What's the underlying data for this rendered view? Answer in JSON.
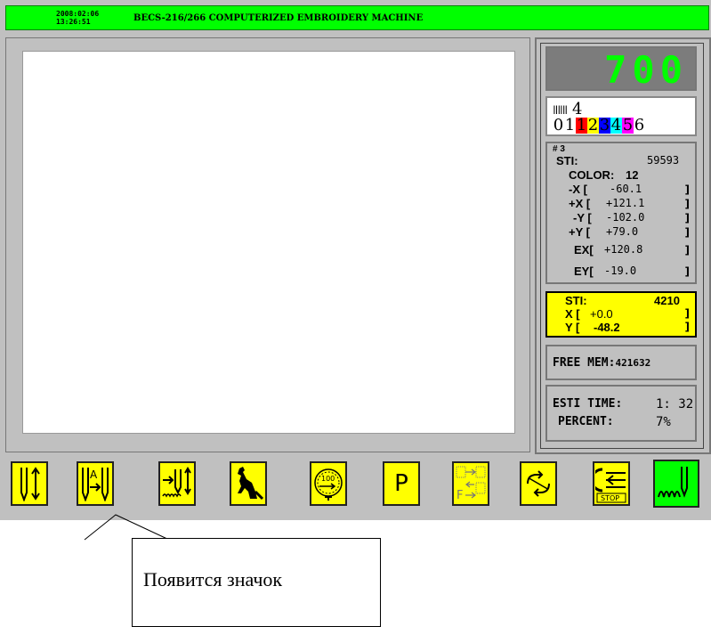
{
  "header": {
    "date": "2008:02:06",
    "time": "13:26:51",
    "title": "BECS-216/266 COMPUTERIZED EMBROIDERY MACHINE"
  },
  "counter": {
    "value": "700",
    "color": "#00ff00"
  },
  "needles": {
    "count_label": "4",
    "colors": [
      {
        "label": "0",
        "bg": "#ffffff",
        "fg": "#000000"
      },
      {
        "label": "1",
        "bg": "#ffffff",
        "fg": "#000000"
      },
      {
        "label": "1",
        "bg": "#ff0000",
        "fg": "#000000"
      },
      {
        "label": "2",
        "bg": "#ffff00",
        "fg": "#000000"
      },
      {
        "label": "3",
        "bg": "#0000ff",
        "fg": "#000000"
      },
      {
        "label": "4",
        "bg": "#00ffff",
        "fg": "#000000"
      },
      {
        "label": "5",
        "bg": "#ff00ff",
        "fg": "#000000"
      },
      {
        "label": "6",
        "bg": "#ffffff",
        "fg": "#000000"
      }
    ]
  },
  "stats": {
    "index": "# 3",
    "sti_label": "STI:",
    "sti_value": "59593",
    "color_label": "COLOR:",
    "color_value": "12",
    "negx_label": "-X [",
    "negx_value": "-60.1",
    "posx_label": "+X [",
    "posx_value": "+121.1",
    "negy_label": "-Y [",
    "negy_value": "-102.0",
    "posy_label": "+Y [",
    "posy_value": "+79.0",
    "ex_label": "EX[",
    "ex_value": "+120.8",
    "ey_label": "EY[",
    "ey_value": "-19.0",
    "bracket": "]"
  },
  "current": {
    "sti_label": "STI:",
    "sti_value": "4210",
    "x_label": "X [",
    "x_value": "+0.0",
    "y_label": "Y [",
    "y_value": "-48.2",
    "bracket": "]"
  },
  "memory": {
    "label": "FREE MEM:",
    "value": "421632"
  },
  "estimate": {
    "time_label": "ESTI TIME:",
    "time_value": "1: 32",
    "percent_label": "PERCENT:",
    "percent_value": "7%"
  },
  "toolbar": {
    "buttons": [
      {
        "name": "needle-up-down-icon"
      },
      {
        "name": "auto-needle-change-icon",
        "text": "A"
      },
      {
        "name": "frame-move-stitch-icon"
      },
      {
        "name": "kangaroo-jump-icon"
      },
      {
        "name": "speed-gauge-icon",
        "text": "100"
      },
      {
        "name": "parameter-icon",
        "text": "P"
      },
      {
        "name": "frame-forward-icon",
        "text": "F"
      },
      {
        "name": "repeat-cycle-icon"
      },
      {
        "name": "stop-return-icon",
        "text": "STOP"
      },
      {
        "name": "embroidery-start-icon"
      }
    ]
  },
  "callout": {
    "text": "Появится значок"
  }
}
